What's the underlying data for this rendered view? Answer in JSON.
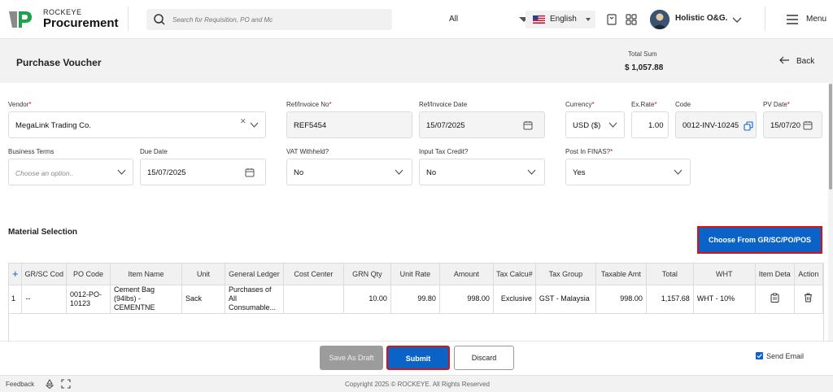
{
  "header": {
    "brand_small": "ROCKEYE",
    "brand_big": "Procurement",
    "search_placeholder": "Search for Requisition, PO and Mc",
    "search_scope": "All",
    "language": "English",
    "user_name": "Holistic O&G.",
    "menu_label": "Menu"
  },
  "page": {
    "title": "Purchase Voucher",
    "total_label": "Total Sum",
    "total_value": "$ 1,057.88",
    "back_label": "Back"
  },
  "form": {
    "vendor": {
      "label": "Vendor",
      "value": "MegaLink Trading Co."
    },
    "ref_invoice_no": {
      "label": "Ref/Invoice No",
      "value": "REF5454"
    },
    "ref_invoice_date": {
      "label": "Ref/Invoice Date",
      "value": "15/07/2025"
    },
    "currency": {
      "label": "Currency",
      "value": "USD ($)"
    },
    "ex_rate": {
      "label": "Ex.Rate",
      "value": "1.00"
    },
    "code": {
      "label": "Code",
      "value": "0012-INV-10245"
    },
    "pv_date": {
      "label": "PV Date",
      "value": "15/07/20"
    },
    "business_terms": {
      "label": "Business Terms",
      "placeholder": "Choose an option.."
    },
    "due_date": {
      "label": "Due Date",
      "value": "15/07/2025"
    },
    "vat_withheld": {
      "label": "VAT Withheld?",
      "value": "No"
    },
    "input_tax_credit": {
      "label": "Input Tax Credit?",
      "value": "No"
    },
    "post_in_finas": {
      "label": "Post In FINAS?",
      "value": "Yes"
    },
    "required_mark": "*"
  },
  "materials": {
    "section_title": "Material Selection",
    "choose_button": "Choose From GR/SC/PO/POS",
    "columns": [
      "+",
      "GR/SC Cod",
      "PO Code",
      "Item Name",
      "Unit",
      "General Ledger",
      "Cost Center",
      "GRN Qty",
      "Unit Rate",
      "Amount",
      "Tax Calcu#",
      "Tax Group",
      "Taxable Amt",
      "Total",
      "WHT",
      "Item Deta",
      "Action"
    ],
    "rows": [
      {
        "no": "1",
        "gr_sc_code": "--",
        "po_code": "0012-PO-10123",
        "item_name": "Cement Bag (94lbs) - CEMENTNE",
        "unit": "Sack",
        "general_ledger": "Purchases of All Consumable...",
        "cost_center": "",
        "grn_qty": "10.00",
        "unit_rate": "99.80",
        "amount": "998.00",
        "tax_calc": "Exclusive",
        "tax_group": "GST - Malaysia",
        "taxable_amt": "998.00",
        "total": "1,157.68",
        "wht": "WHT - 10%"
      }
    ]
  },
  "footer": {
    "draft_button": "Save As Draft",
    "submit_button": "Submit",
    "discard_button": "Discard",
    "send_email": "Send Email",
    "feedback": "Feedback",
    "copyright": "Copyright 2025 © ROCKEYE. All Rights Reserved"
  },
  "colors": {
    "primary": "#0c63c7",
    "highlight": "#dd1111"
  }
}
